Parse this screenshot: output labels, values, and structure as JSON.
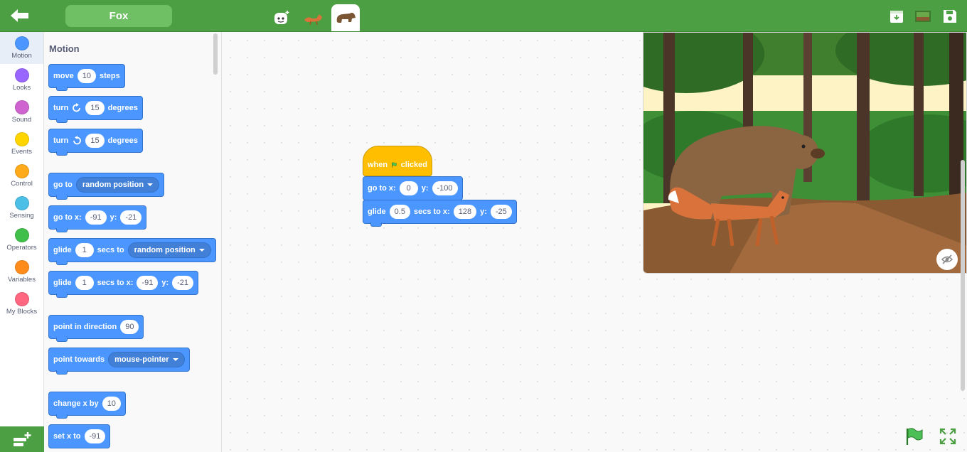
{
  "header": {
    "sprite_name": "Fox",
    "tabs": [
      "code-tab",
      "costume-tab",
      "sound-tab"
    ],
    "accent": "#4ca043"
  },
  "categories": [
    {
      "label": "Motion",
      "color": "#4c97ff"
    },
    {
      "label": "Looks",
      "color": "#9966ff"
    },
    {
      "label": "Sound",
      "color": "#cf63cf"
    },
    {
      "label": "Events",
      "color": "#ffd500"
    },
    {
      "label": "Control",
      "color": "#ffab19"
    },
    {
      "label": "Sensing",
      "color": "#4cbfe6"
    },
    {
      "label": "Operators",
      "color": "#40bf4a"
    },
    {
      "label": "Variables",
      "color": "#ff8c1a"
    },
    {
      "label": "My Blocks",
      "color": "#ff6680"
    }
  ],
  "palette": {
    "title": "Motion",
    "move": {
      "label": "move",
      "value": "10",
      "suffix": "steps"
    },
    "turn_right": {
      "label": "turn",
      "value": "15",
      "suffix": "degrees"
    },
    "turn_left": {
      "label": "turn",
      "value": "15",
      "suffix": "degrees"
    },
    "go_to": {
      "label": "go to",
      "option": "random position"
    },
    "go_to_xy": {
      "label": "go to x:",
      "x": "-91",
      "y_label": "y:",
      "y": "-21"
    },
    "glide_to": {
      "label": "glide",
      "value": "1",
      "mid": "secs to",
      "option": "random position"
    },
    "glide_xy": {
      "label": "glide",
      "value": "1",
      "mid": "secs to x:",
      "x": "-91",
      "y_label": "y:",
      "y": "-21"
    },
    "point_dir": {
      "label": "point in direction",
      "value": "90"
    },
    "point_towards": {
      "label": "point towards",
      "option": "mouse-pointer"
    },
    "change_x": {
      "label": "change x by",
      "value": "10"
    },
    "set_x": {
      "label": "set x to",
      "value": "-91"
    }
  },
  "script": {
    "hat": {
      "before": "when",
      "after": "clicked"
    },
    "goto": {
      "label": "go to x:",
      "x": "0",
      "y_label": "y:",
      "y": "-100"
    },
    "glide": {
      "label": "glide",
      "secs": "0.5",
      "mid": "secs to x:",
      "x": "128",
      "y_label": "y:",
      "y": "-25"
    }
  }
}
